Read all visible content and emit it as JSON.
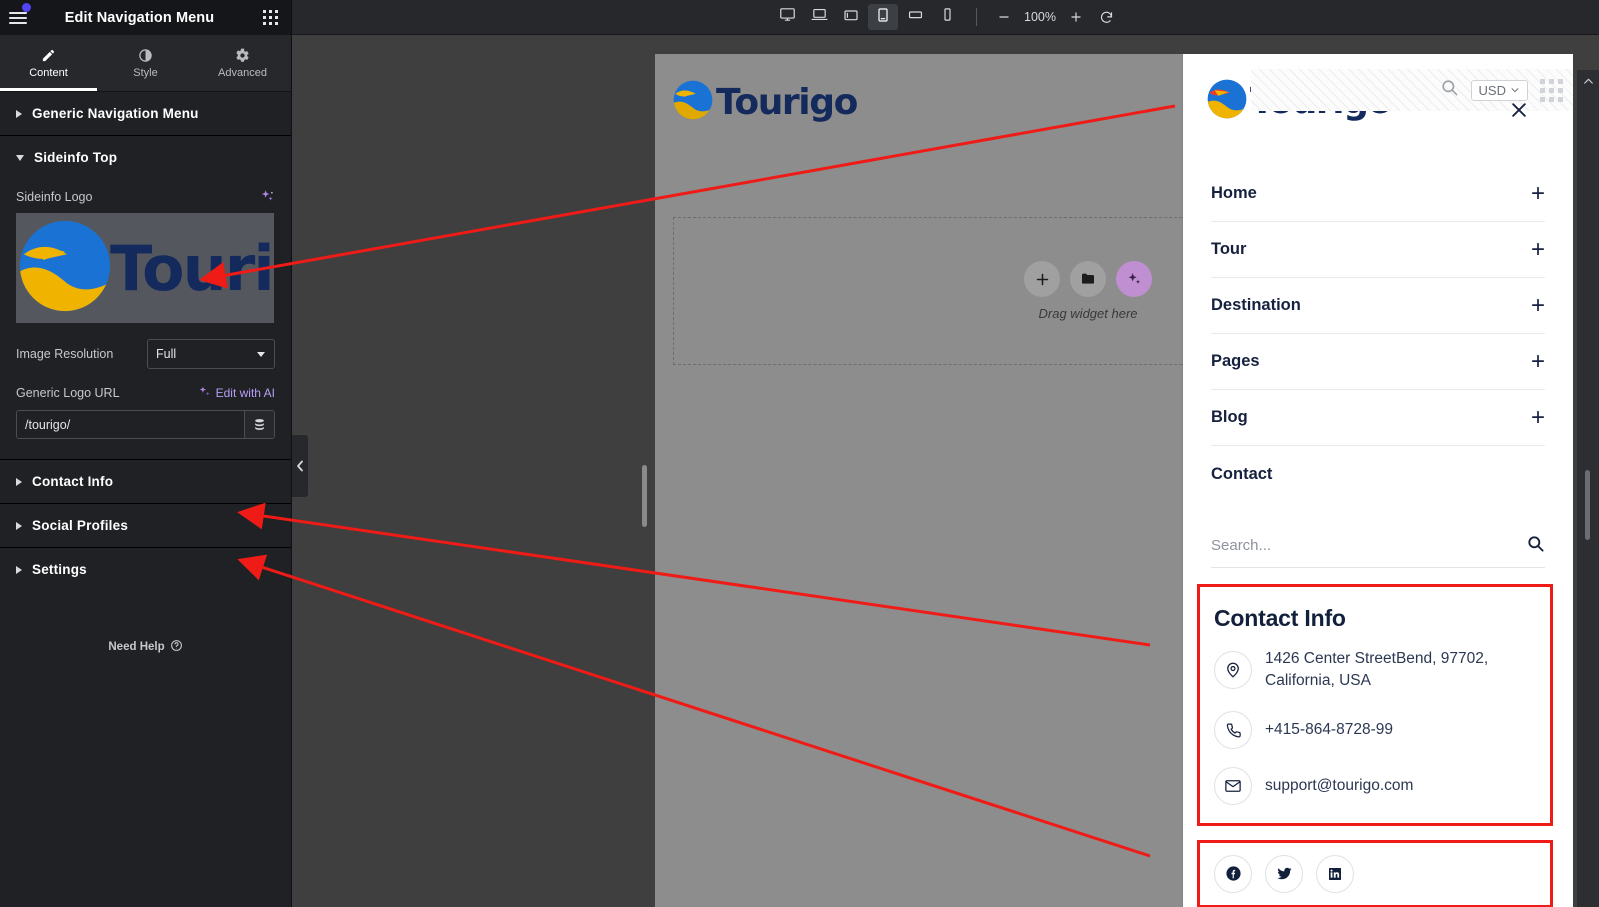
{
  "panel": {
    "title": "Edit Navigation Menu",
    "tabs": [
      {
        "label": "Content",
        "icon": "pencil-icon",
        "active": true
      },
      {
        "label": "Style",
        "icon": "contrast-icon",
        "active": false
      },
      {
        "label": "Advanced",
        "icon": "gear-icon",
        "active": false
      }
    ],
    "sections": [
      {
        "label": "Generic Navigation Menu",
        "expanded": false
      },
      {
        "label": "Sideinfo Top",
        "expanded": true
      },
      {
        "label": "Contact Info",
        "expanded": false
      },
      {
        "label": "Social Profiles",
        "expanded": false
      },
      {
        "label": "Settings",
        "expanded": false
      }
    ],
    "sideinfo": {
      "logo_field_label": "Sideinfo Logo",
      "logo_wordmark": "Tourigo",
      "image_resolution_label": "Image Resolution",
      "image_resolution_value": "Full",
      "generic_logo_url_label": "Generic Logo URL",
      "edit_with_ai_label": "Edit with AI",
      "url_value": "/tourigo/",
      "url_placeholder": ""
    },
    "need_help": "Need Help"
  },
  "topbar": {
    "devices": [
      {
        "name": "desktop",
        "active": false
      },
      {
        "name": "laptop",
        "active": false
      },
      {
        "name": "tablet-landscape",
        "active": false
      },
      {
        "name": "tablet-portrait",
        "active": true
      },
      {
        "name": "mobile-landscape",
        "active": false
      },
      {
        "name": "mobile-portrait",
        "active": false
      }
    ],
    "zoom_out_label": "−",
    "zoom_value": "100%",
    "zoom_in_label": "+",
    "reset_label": "↺"
  },
  "canvas": {
    "preview_logo_wordmark": "Tourigo",
    "dropzone_text": "Drag widget here",
    "dropzone_buttons": [
      "add-element",
      "folder-template",
      "ai-generate"
    ]
  },
  "nav_overlay": {
    "logo_wordmark": "Tourigo",
    "currency": "USD",
    "search_icon": "search-icon",
    "grid_icon": "grid-dots-icon",
    "close_icon": "close-icon",
    "menu_items": [
      {
        "label": "Home",
        "has_toggle": true
      },
      {
        "label": "Tour",
        "has_toggle": true
      },
      {
        "label": "Destination",
        "has_toggle": true
      },
      {
        "label": "Pages",
        "has_toggle": true
      },
      {
        "label": "Blog",
        "has_toggle": true
      },
      {
        "label": "Contact",
        "has_toggle": false
      }
    ],
    "search_placeholder": "Search...",
    "contact_info": {
      "title": "Contact Info",
      "address": "1426 Center StreetBend, 97702, California, USA",
      "phone": "+415-864-8728-99",
      "email": "support@tourigo.com"
    },
    "social": [
      {
        "name": "facebook"
      },
      {
        "name": "twitter"
      },
      {
        "name": "linkedin"
      }
    ]
  },
  "colors": {
    "panel_bg": "#1f2124",
    "panel_header_bg": "#14161a",
    "accent_ai": "#b79ff5",
    "annotation_red": "#ef1b16",
    "brand_navy": "#152a5c",
    "brand_blue": "#1a73d4",
    "brand_gold": "#f0b400"
  }
}
